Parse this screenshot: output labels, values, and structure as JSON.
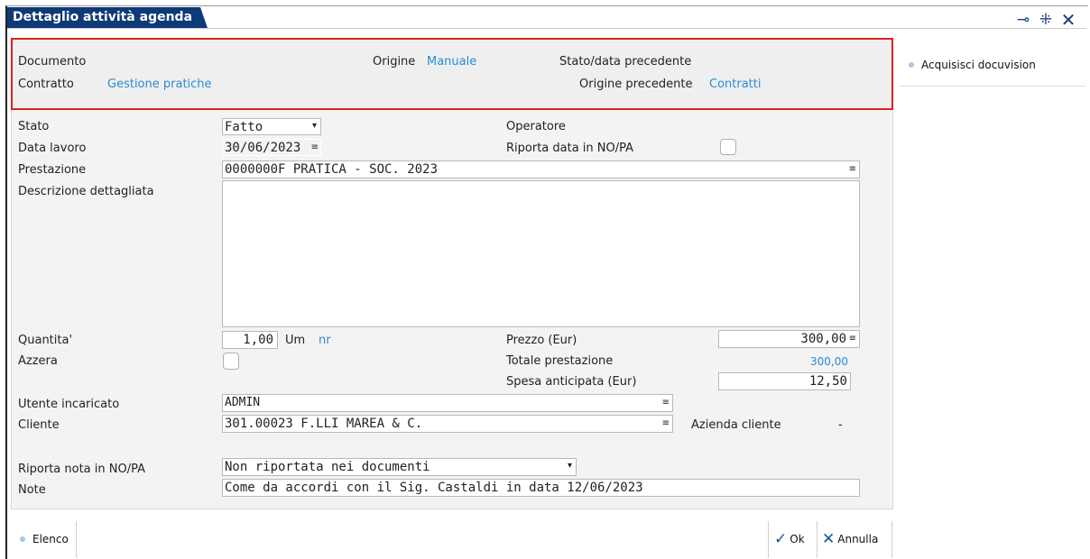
{
  "window": {
    "title": "Dettaglio attività agenda"
  },
  "header": {
    "documento_label": "Documento",
    "origine_label": "Origine",
    "origine_value": "Manuale",
    "stato_precedente_label": "Stato/data precedente",
    "contratto_label": "Contratto",
    "contratto_value": "Gestione pratiche",
    "origine_precedente_label": "Origine precedente",
    "origine_precedente_value": "Contratti"
  },
  "side": {
    "acquisisci_label": "Acquisisci docuvision"
  },
  "form": {
    "stato_label": "Stato",
    "stato_value": "Fatto",
    "operatore_label": "Operatore",
    "data_lavoro_label": "Data lavoro",
    "data_lavoro_value": "30/06/2023",
    "riporta_data_label": "Riporta data in NO/PA",
    "prestazione_label": "Prestazione",
    "prestazione_value": "0000000F PRATICA - SOC. 2023",
    "descrizione_label": "Descrizione dettagliata",
    "descrizione_value": "",
    "quantita_label": "Quantita'",
    "quantita_value": "1,00",
    "um_label": "Um",
    "um_value": "nr",
    "prezzo_label": "Prezzo (Eur)",
    "prezzo_value": "300,00",
    "azzera_label": "Azzera",
    "totale_label": "Totale prestazione",
    "totale_value": "300,00",
    "spesa_label": "Spesa anticipata (Eur)",
    "spesa_value": "12,50",
    "utente_label": "Utente incaricato",
    "utente_value": "ADMIN",
    "cliente_label": "Cliente",
    "cliente_value": "301.00023 F.LLI MAREA & C.",
    "azienda_label": "Azienda cliente",
    "azienda_value": "-",
    "riporta_nota_label": "Riporta nota in NO/PA",
    "riporta_nota_value": "Non riportata nei documenti",
    "note_label": "Note",
    "note_value": "Come da accordi con il Sig. Castaldi in data 12/06/2023"
  },
  "footer": {
    "elenco_label": "Elenco",
    "ok_label": "Ok",
    "annulla_label": "Annulla"
  },
  "icons": {
    "pin": "pin-icon",
    "collapse": "collapse-icon",
    "close": "close-icon",
    "check": "check-icon",
    "cancel": "x-icon"
  },
  "colors": {
    "title_bg": "#0f3a78",
    "link": "#2a8bd0",
    "highlight_border": "#e02020"
  }
}
